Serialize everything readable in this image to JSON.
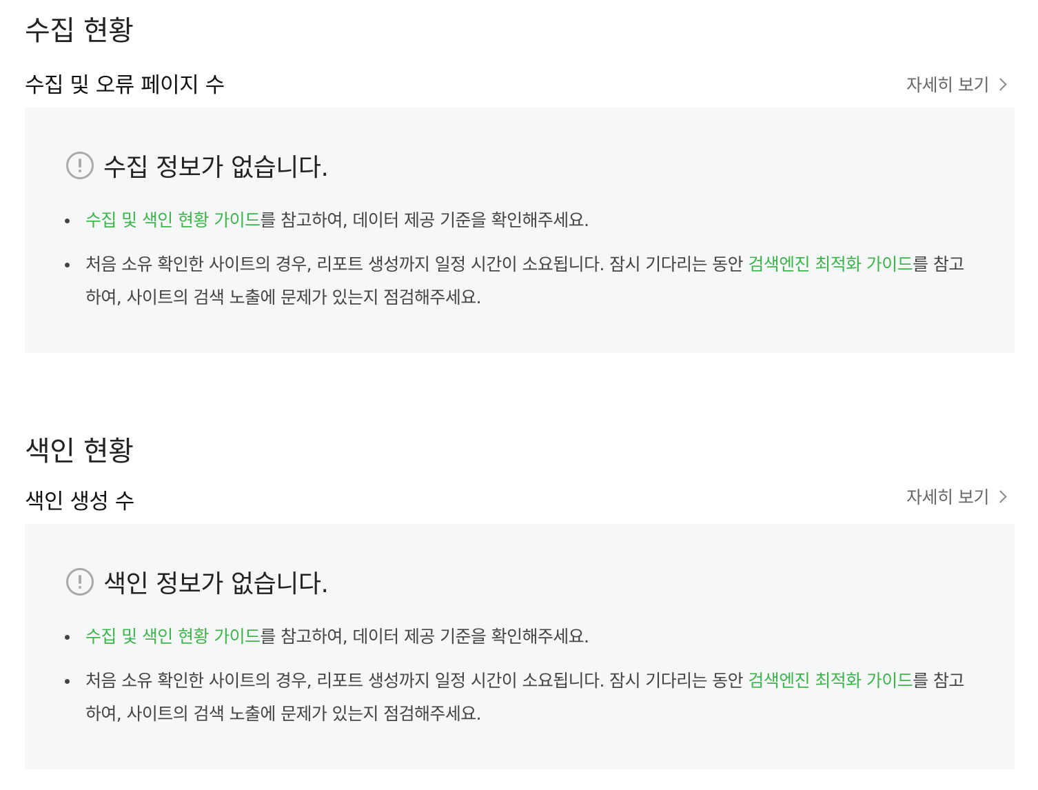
{
  "sections": [
    {
      "title": "수집 현황",
      "subtitle": "수집 및 오류 페이지 수",
      "more_label": "자세히 보기",
      "empty_title": "수집 정보가 없습니다.",
      "bullets": [
        {
          "link_text": "수집 및 색인 현황 가이드",
          "text": "를 참고하여, 데이터 제공 기준을 확인해주세요."
        },
        {
          "text_before": "처음 소유 확인한 사이트의 경우, 리포트 생성까지 일정 시간이 소요됩니다. 잠시 기다리는 동안 ",
          "link_text": "검색엔진 최적화 가이드",
          "text_after": "를 참고하여, 사이트의 검색 노출에 문제가 있는지 점검해주세요."
        }
      ]
    },
    {
      "title": "색인 현황",
      "subtitle": "색인 생성 수",
      "more_label": "자세히 보기",
      "empty_title": "색인 정보가 없습니다.",
      "bullets": [
        {
          "link_text": "수집 및 색인 현황 가이드",
          "text": "를 참고하여, 데이터 제공 기준을 확인해주세요."
        },
        {
          "text_before": "처음 소유 확인한 사이트의 경우, 리포트 생성까지 일정 시간이 소요됩니다. 잠시 기다리는 동안 ",
          "link_text": "검색엔진 최적화 가이드",
          "text_after": "를 참고하여, 사이트의 검색 노출에 문제가 있는지 점검해주세요."
        }
      ]
    }
  ],
  "colors": {
    "link": "#3db54a",
    "panel_bg": "#f6f7f9",
    "icon": "#a9a9a9"
  },
  "icons": {
    "alert": "exclamation-circle-icon",
    "more": "chevron-right-icon"
  }
}
